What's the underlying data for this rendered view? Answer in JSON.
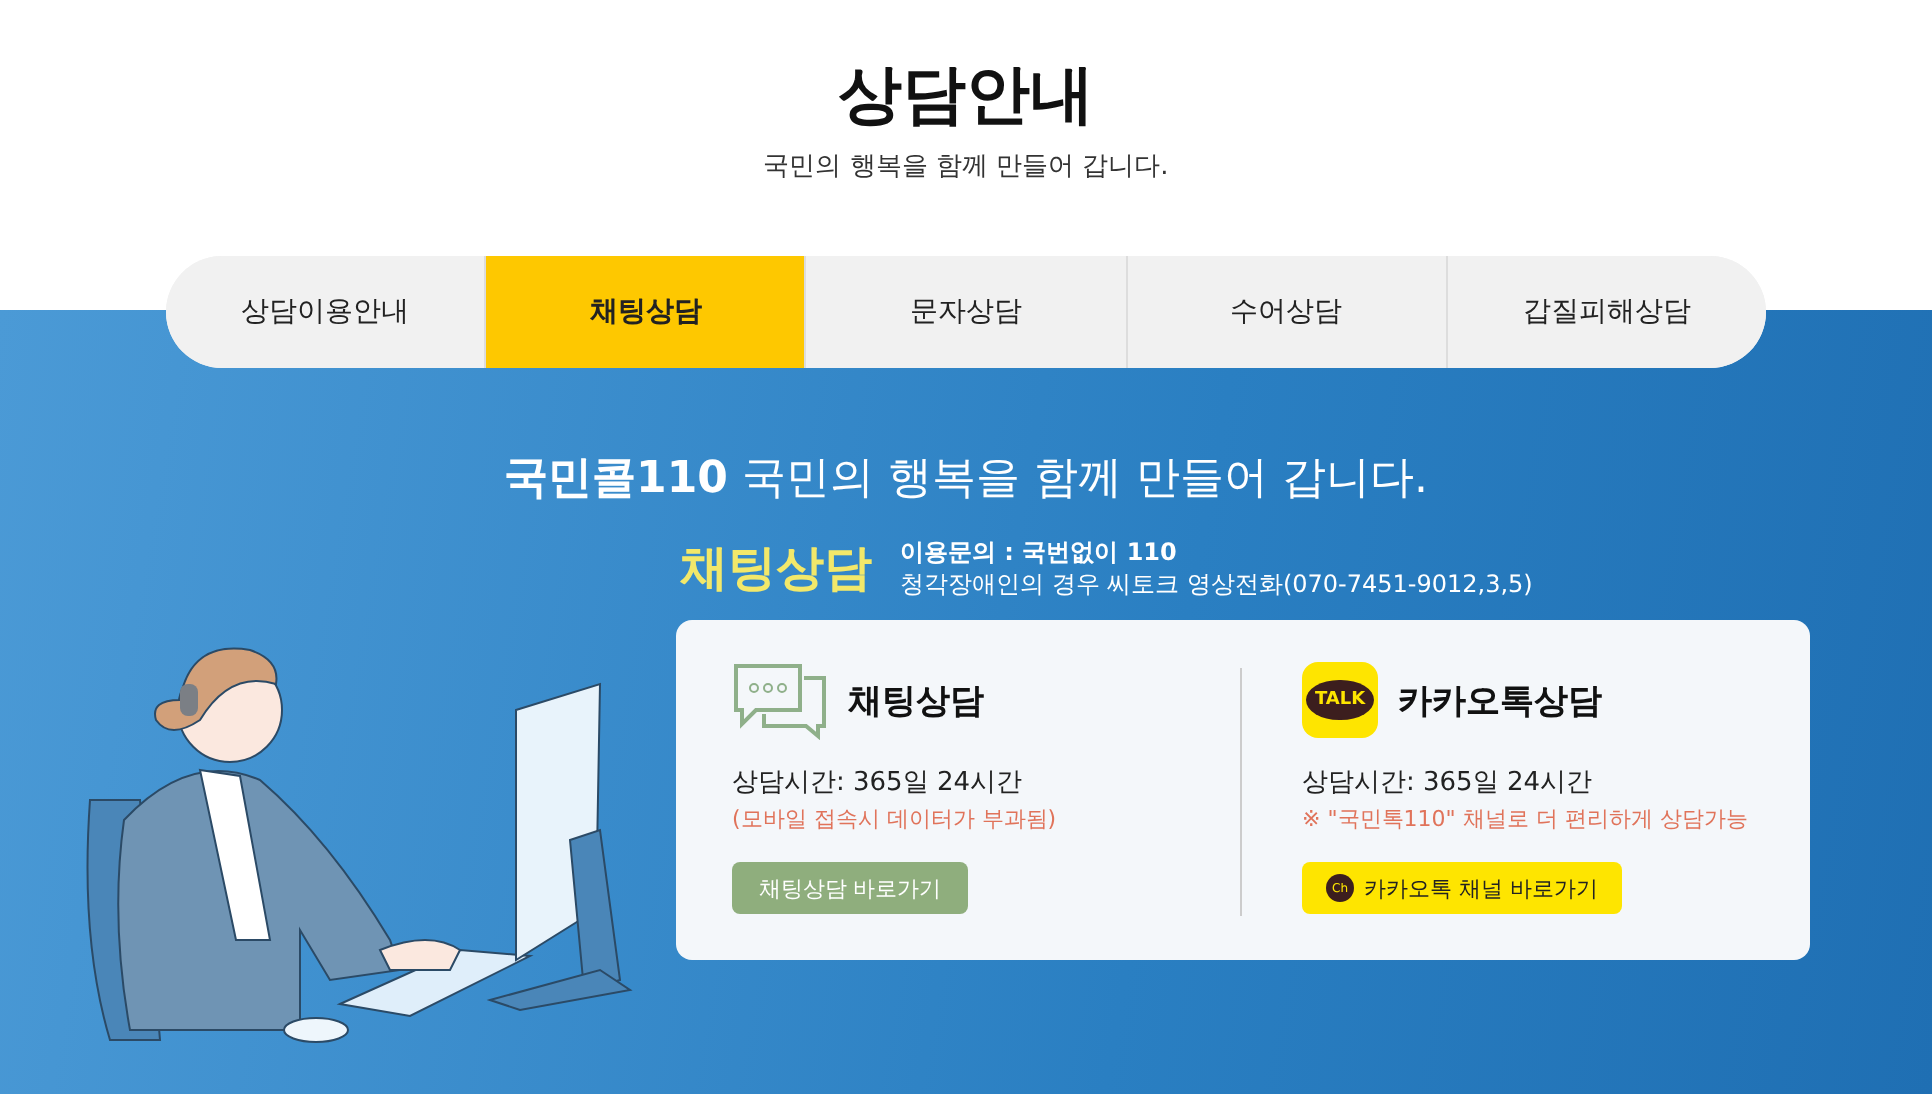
{
  "header": {
    "title": "상담안내",
    "subtitle": "국민의 행복을 함께 만들어 갑니다."
  },
  "tabs": [
    {
      "label": "상담이용안내",
      "selected": false
    },
    {
      "label": "채팅상담",
      "selected": true
    },
    {
      "label": "문자상담",
      "selected": false
    },
    {
      "label": "수어상담",
      "selected": false
    },
    {
      "label": "갑질피해상담",
      "selected": false
    }
  ],
  "headline": "**국민콜110** 국민의 행복을 함께 만들어 갑니다.",
  "section": {
    "title": "채팅상담",
    "inquiry": "이용문의 : 국번없이 110",
    "note": "청각장애인의 경우 씨토크 영상전화(070-7451-9012,3,5)"
  },
  "cards": [
    {
      "kind": "chat",
      "title": "채팅상담",
      "hours": "상담시간: 365일 24시간",
      "notice": "(모바일 접속시 데이터가 부과됨)",
      "button": "채팅상담 바로가기"
    },
    {
      "kind": "kakao",
      "title": "카카오톡상담",
      "icon_text": "TALK",
      "hours": "상담시간: 365일 24시간",
      "notice": "※ \"국민톡110\" 채널로 더 편리하게 상담가능",
      "button_icon_text": "Ch",
      "button": "카카오톡 채널 바로가기"
    }
  ]
}
